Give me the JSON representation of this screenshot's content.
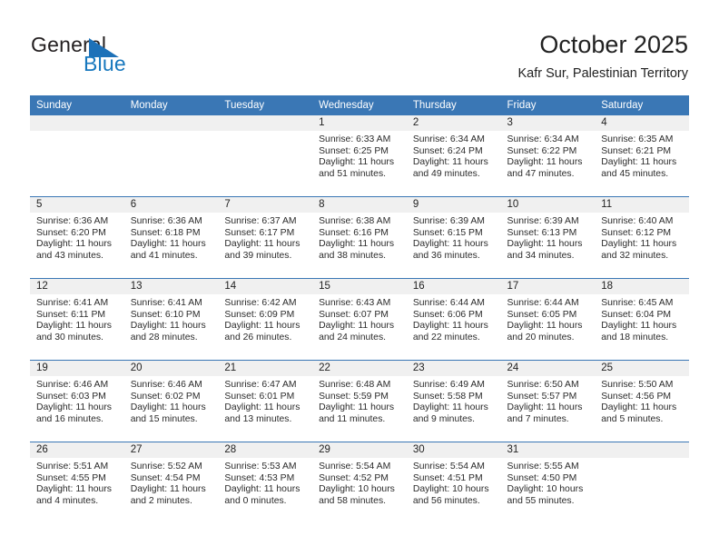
{
  "brand": {
    "name_part1": "General",
    "name_part2": "Blue",
    "logo_icon": "triangle-flag-icon",
    "color_blue": "#1878be",
    "color_dark": "#231f20"
  },
  "header": {
    "month_title": "October 2025",
    "location": "Kafr Sur, Palestinian Territory"
  },
  "theme": {
    "header_row_bg": "#3a77b5",
    "daynum_band_bg": "#f0f0f0",
    "grid_line": "#3a77b5",
    "text": "#222222"
  },
  "calendar": {
    "weekday_headers": [
      "Sunday",
      "Monday",
      "Tuesday",
      "Wednesday",
      "Thursday",
      "Friday",
      "Saturday"
    ],
    "weeks": [
      [
        {
          "day": "",
          "empty": true
        },
        {
          "day": "",
          "empty": true
        },
        {
          "day": "",
          "empty": true
        },
        {
          "day": "1",
          "sunrise": "Sunrise: 6:33 AM",
          "sunset": "Sunset: 6:25 PM",
          "daylight_line1": "Daylight: 11 hours",
          "daylight_line2": "and 51 minutes."
        },
        {
          "day": "2",
          "sunrise": "Sunrise: 6:34 AM",
          "sunset": "Sunset: 6:24 PM",
          "daylight_line1": "Daylight: 11 hours",
          "daylight_line2": "and 49 minutes."
        },
        {
          "day": "3",
          "sunrise": "Sunrise: 6:34 AM",
          "sunset": "Sunset: 6:22 PM",
          "daylight_line1": "Daylight: 11 hours",
          "daylight_line2": "and 47 minutes."
        },
        {
          "day": "4",
          "sunrise": "Sunrise: 6:35 AM",
          "sunset": "Sunset: 6:21 PM",
          "daylight_line1": "Daylight: 11 hours",
          "daylight_line2": "and 45 minutes."
        }
      ],
      [
        {
          "day": "5",
          "sunrise": "Sunrise: 6:36 AM",
          "sunset": "Sunset: 6:20 PM",
          "daylight_line1": "Daylight: 11 hours",
          "daylight_line2": "and 43 minutes."
        },
        {
          "day": "6",
          "sunrise": "Sunrise: 6:36 AM",
          "sunset": "Sunset: 6:18 PM",
          "daylight_line1": "Daylight: 11 hours",
          "daylight_line2": "and 41 minutes."
        },
        {
          "day": "7",
          "sunrise": "Sunrise: 6:37 AM",
          "sunset": "Sunset: 6:17 PM",
          "daylight_line1": "Daylight: 11 hours",
          "daylight_line2": "and 39 minutes."
        },
        {
          "day": "8",
          "sunrise": "Sunrise: 6:38 AM",
          "sunset": "Sunset: 6:16 PM",
          "daylight_line1": "Daylight: 11 hours",
          "daylight_line2": "and 38 minutes."
        },
        {
          "day": "9",
          "sunrise": "Sunrise: 6:39 AM",
          "sunset": "Sunset: 6:15 PM",
          "daylight_line1": "Daylight: 11 hours",
          "daylight_line2": "and 36 minutes."
        },
        {
          "day": "10",
          "sunrise": "Sunrise: 6:39 AM",
          "sunset": "Sunset: 6:13 PM",
          "daylight_line1": "Daylight: 11 hours",
          "daylight_line2": "and 34 minutes."
        },
        {
          "day": "11",
          "sunrise": "Sunrise: 6:40 AM",
          "sunset": "Sunset: 6:12 PM",
          "daylight_line1": "Daylight: 11 hours",
          "daylight_line2": "and 32 minutes."
        }
      ],
      [
        {
          "day": "12",
          "sunrise": "Sunrise: 6:41 AM",
          "sunset": "Sunset: 6:11 PM",
          "daylight_line1": "Daylight: 11 hours",
          "daylight_line2": "and 30 minutes."
        },
        {
          "day": "13",
          "sunrise": "Sunrise: 6:41 AM",
          "sunset": "Sunset: 6:10 PM",
          "daylight_line1": "Daylight: 11 hours",
          "daylight_line2": "and 28 minutes."
        },
        {
          "day": "14",
          "sunrise": "Sunrise: 6:42 AM",
          "sunset": "Sunset: 6:09 PM",
          "daylight_line1": "Daylight: 11 hours",
          "daylight_line2": "and 26 minutes."
        },
        {
          "day": "15",
          "sunrise": "Sunrise: 6:43 AM",
          "sunset": "Sunset: 6:07 PM",
          "daylight_line1": "Daylight: 11 hours",
          "daylight_line2": "and 24 minutes."
        },
        {
          "day": "16",
          "sunrise": "Sunrise: 6:44 AM",
          "sunset": "Sunset: 6:06 PM",
          "daylight_line1": "Daylight: 11 hours",
          "daylight_line2": "and 22 minutes."
        },
        {
          "day": "17",
          "sunrise": "Sunrise: 6:44 AM",
          "sunset": "Sunset: 6:05 PM",
          "daylight_line1": "Daylight: 11 hours",
          "daylight_line2": "and 20 minutes."
        },
        {
          "day": "18",
          "sunrise": "Sunrise: 6:45 AM",
          "sunset": "Sunset: 6:04 PM",
          "daylight_line1": "Daylight: 11 hours",
          "daylight_line2": "and 18 minutes."
        }
      ],
      [
        {
          "day": "19",
          "sunrise": "Sunrise: 6:46 AM",
          "sunset": "Sunset: 6:03 PM",
          "daylight_line1": "Daylight: 11 hours",
          "daylight_line2": "and 16 minutes."
        },
        {
          "day": "20",
          "sunrise": "Sunrise: 6:46 AM",
          "sunset": "Sunset: 6:02 PM",
          "daylight_line1": "Daylight: 11 hours",
          "daylight_line2": "and 15 minutes."
        },
        {
          "day": "21",
          "sunrise": "Sunrise: 6:47 AM",
          "sunset": "Sunset: 6:01 PM",
          "daylight_line1": "Daylight: 11 hours",
          "daylight_line2": "and 13 minutes."
        },
        {
          "day": "22",
          "sunrise": "Sunrise: 6:48 AM",
          "sunset": "Sunset: 5:59 PM",
          "daylight_line1": "Daylight: 11 hours",
          "daylight_line2": "and 11 minutes."
        },
        {
          "day": "23",
          "sunrise": "Sunrise: 6:49 AM",
          "sunset": "Sunset: 5:58 PM",
          "daylight_line1": "Daylight: 11 hours",
          "daylight_line2": "and 9 minutes."
        },
        {
          "day": "24",
          "sunrise": "Sunrise: 6:50 AM",
          "sunset": "Sunset: 5:57 PM",
          "daylight_line1": "Daylight: 11 hours",
          "daylight_line2": "and 7 minutes."
        },
        {
          "day": "25",
          "sunrise": "Sunrise: 5:50 AM",
          "sunset": "Sunset: 4:56 PM",
          "daylight_line1": "Daylight: 11 hours",
          "daylight_line2": "and 5 minutes."
        }
      ],
      [
        {
          "day": "26",
          "sunrise": "Sunrise: 5:51 AM",
          "sunset": "Sunset: 4:55 PM",
          "daylight_line1": "Daylight: 11 hours",
          "daylight_line2": "and 4 minutes."
        },
        {
          "day": "27",
          "sunrise": "Sunrise: 5:52 AM",
          "sunset": "Sunset: 4:54 PM",
          "daylight_line1": "Daylight: 11 hours",
          "daylight_line2": "and 2 minutes."
        },
        {
          "day": "28",
          "sunrise": "Sunrise: 5:53 AM",
          "sunset": "Sunset: 4:53 PM",
          "daylight_line1": "Daylight: 11 hours",
          "daylight_line2": "and 0 minutes."
        },
        {
          "day": "29",
          "sunrise": "Sunrise: 5:54 AM",
          "sunset": "Sunset: 4:52 PM",
          "daylight_line1": "Daylight: 10 hours",
          "daylight_line2": "and 58 minutes."
        },
        {
          "day": "30",
          "sunrise": "Sunrise: 5:54 AM",
          "sunset": "Sunset: 4:51 PM",
          "daylight_line1": "Daylight: 10 hours",
          "daylight_line2": "and 56 minutes."
        },
        {
          "day": "31",
          "sunrise": "Sunrise: 5:55 AM",
          "sunset": "Sunset: 4:50 PM",
          "daylight_line1": "Daylight: 10 hours",
          "daylight_line2": "and 55 minutes."
        },
        {
          "day": "",
          "empty": true
        }
      ]
    ]
  }
}
